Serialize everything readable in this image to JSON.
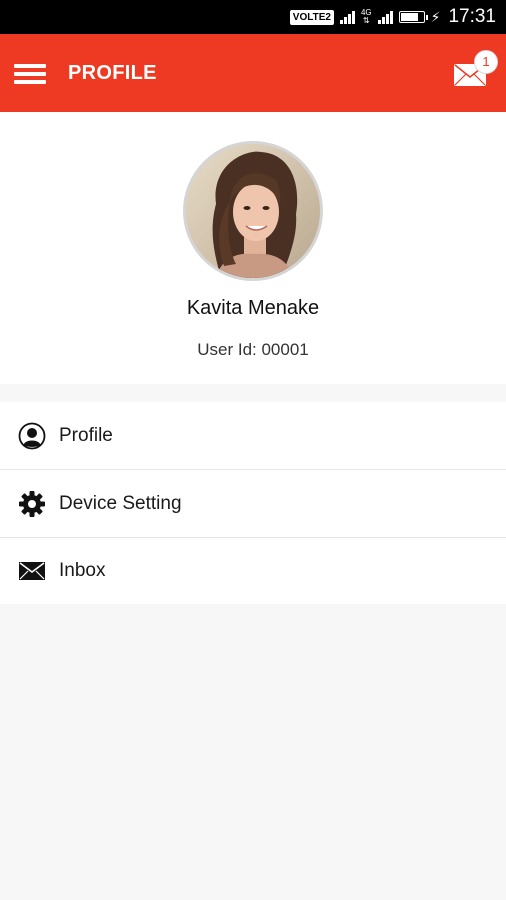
{
  "status_bar": {
    "network_badge": "VOLTE2",
    "network_type_top": "4G",
    "network_type_bottom": "",
    "battery_level": 0.8,
    "time": "17:31"
  },
  "app_bar": {
    "title": "PROFILE",
    "menu_icon": "hamburger-menu-icon",
    "mail_icon": "envelope-icon",
    "unread_count": "1",
    "color": "#ee3a22"
  },
  "profile": {
    "name": "Kavita Menake",
    "user_id": "User Id: 00001"
  },
  "menu": {
    "items": [
      {
        "label": "Profile",
        "icon": "person-icon"
      },
      {
        "label": "Device Setting",
        "icon": "gear-icon"
      },
      {
        "label": "Inbox",
        "icon": "envelope-icon"
      }
    ]
  }
}
